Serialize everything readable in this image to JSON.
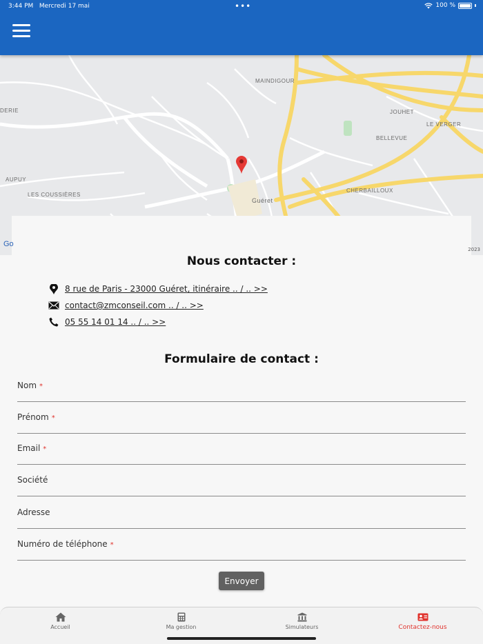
{
  "status_bar": {
    "time": "3:44 PM",
    "date": "Mercredi 17 mai",
    "dots": "•••",
    "battery": "100 %"
  },
  "map": {
    "google_label": "Go",
    "year_label": "2023",
    "place_labels": [
      "Guéret",
      "LES COUSSIERES",
      "AUPUY",
      "DERIE",
      "LE VERGER",
      "JOUHET",
      "BELLEVUE",
      "CHERBAILLOUX",
      "MAINDIGOUR"
    ]
  },
  "contact": {
    "title": "Nous contacter :",
    "address": "8 rue de Paris - 23000 Guéret, itinéraire .. / .. >>",
    "email": "contact@zmconseil.com .. / .. >>",
    "phone": "05 55 14 01 14  .. / .. >>"
  },
  "form": {
    "title": "Formulaire de contact :",
    "fields": [
      {
        "label": "Nom",
        "required": "*"
      },
      {
        "label": "Prénom",
        "required": "*"
      },
      {
        "label": "Email",
        "required": "*"
      },
      {
        "label": "Société",
        "required": ""
      },
      {
        "label": "Adresse",
        "required": ""
      },
      {
        "label": "Numéro de téléphone",
        "required": "*"
      }
    ],
    "submit_label": "Envoyer"
  },
  "bottom_nav": {
    "items": [
      {
        "label": "Accueil",
        "icon": "home-icon"
      },
      {
        "label": "Ma gestion",
        "icon": "calculator-icon"
      },
      {
        "label": "Simulateurs",
        "icon": "bank-icon"
      },
      {
        "label": "Contactez-nous",
        "icon": "contact-card-icon"
      }
    ],
    "active_color": "#e0342e"
  },
  "colors": {
    "appbar": "#1b66c1",
    "map_pin": "#e53935"
  }
}
